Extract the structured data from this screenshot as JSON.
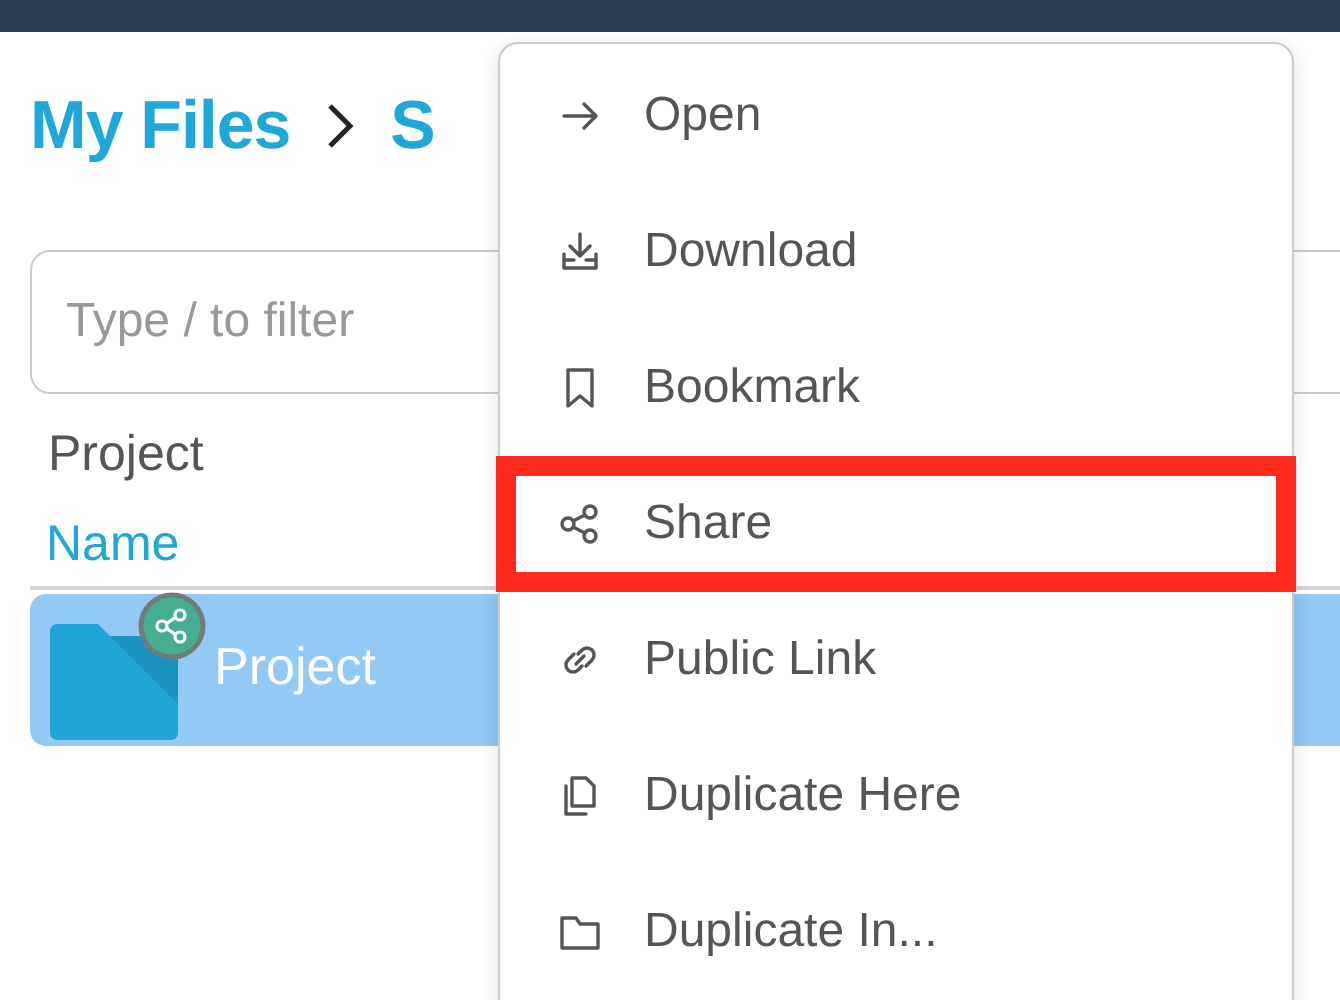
{
  "breadcrumb": [
    {
      "label": "My Files"
    },
    {
      "label": "S"
    }
  ],
  "filter": {
    "placeholder": "Type / to filter"
  },
  "current_folder": "Project",
  "table": {
    "columns": [
      "Name"
    ],
    "rows": [
      {
        "name": "Project",
        "selected": true,
        "shared": true
      }
    ]
  },
  "context_menu": [
    {
      "label": "Open",
      "kind": "arrow",
      "highlighted": false
    },
    {
      "label": "Download",
      "kind": "download",
      "highlighted": false
    },
    {
      "label": "Bookmark",
      "kind": "bookmark",
      "highlighted": false
    },
    {
      "label": "Share",
      "kind": "share",
      "highlighted": true
    },
    {
      "label": "Public Link",
      "kind": "link",
      "highlighted": false
    },
    {
      "label": "Duplicate Here",
      "kind": "copy",
      "highlighted": false
    },
    {
      "label": "Duplicate In...",
      "kind": "folder",
      "highlighted": false
    }
  ]
}
